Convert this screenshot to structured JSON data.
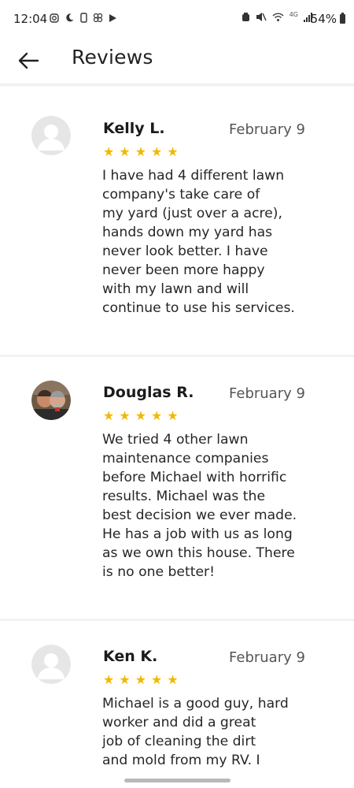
{
  "status_bar": {
    "time": "12:04",
    "battery": "54%",
    "network": "4G"
  },
  "header": {
    "title": "Reviews",
    "back_icon": "arrow-left-icon"
  },
  "reviews": [
    {
      "name": "Kelly L.",
      "date": "February 9",
      "rating": 5,
      "avatar": "default-avatar-icon",
      "text_lines": [
        "I have had 4 different lawn",
        "company's take care of",
        "my yard (just over a acre),",
        "hands down my yard has",
        "never look better. I have",
        "never been more happy",
        "with my lawn and will",
        "continue to use his services."
      ]
    },
    {
      "name": "Douglas R.",
      "date": "February 9",
      "rating": 5,
      "avatar": "photo-avatar",
      "text_lines": [
        "We tried 4 other lawn",
        "maintenance companies",
        "before Michael with horrific",
        "results. Michael was the",
        "best decision we ever made.",
        "He has a job with us as long",
        "as we own this house. There",
        "is no one better!"
      ]
    },
    {
      "name": "Ken K.",
      "date": "February 9",
      "rating": 5,
      "avatar": "default-avatar-icon",
      "text_lines": [
        "Michael is a good guy, hard",
        "worker and did a great",
        "job of cleaning the dirt",
        "and mold from my RV. I"
      ]
    }
  ],
  "colors": {
    "star": "#f2b705",
    "divider": "#f2f2f2",
    "text": "#262626"
  }
}
